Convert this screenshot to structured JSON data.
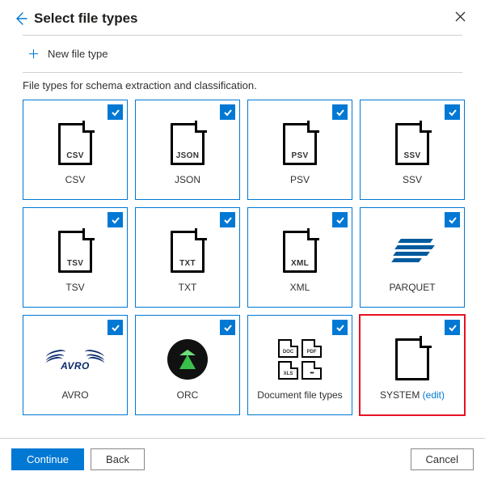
{
  "header": {
    "title": "Select file types"
  },
  "newFileType": {
    "label": "New file type"
  },
  "description": "File types for schema extraction and classification.",
  "tiles": {
    "csv": {
      "label": "CSV",
      "iconText": "CSV"
    },
    "json": {
      "label": "JSON",
      "iconText": "JSON"
    },
    "psv": {
      "label": "PSV",
      "iconText": "PSV"
    },
    "ssv": {
      "label": "SSV",
      "iconText": "SSV"
    },
    "tsv": {
      "label": "TSV",
      "iconText": "TSV"
    },
    "txt": {
      "label": "TXT",
      "iconText": "TXT"
    },
    "xml": {
      "label": "XML",
      "iconText": "XML"
    },
    "parquet": {
      "label": "PARQUET"
    },
    "avro": {
      "label": "AVRO",
      "iconText": "AVRO"
    },
    "orc": {
      "label": "ORC"
    },
    "docs": {
      "label": "Document file types",
      "mini": {
        "a": "DOC",
        "b": "PDF",
        "c": "XLS",
        "d": ""
      }
    },
    "system": {
      "label": "SYSTEM",
      "edit": "(edit)"
    }
  },
  "footer": {
    "continue": "Continue",
    "back": "Back",
    "cancel": "Cancel"
  }
}
